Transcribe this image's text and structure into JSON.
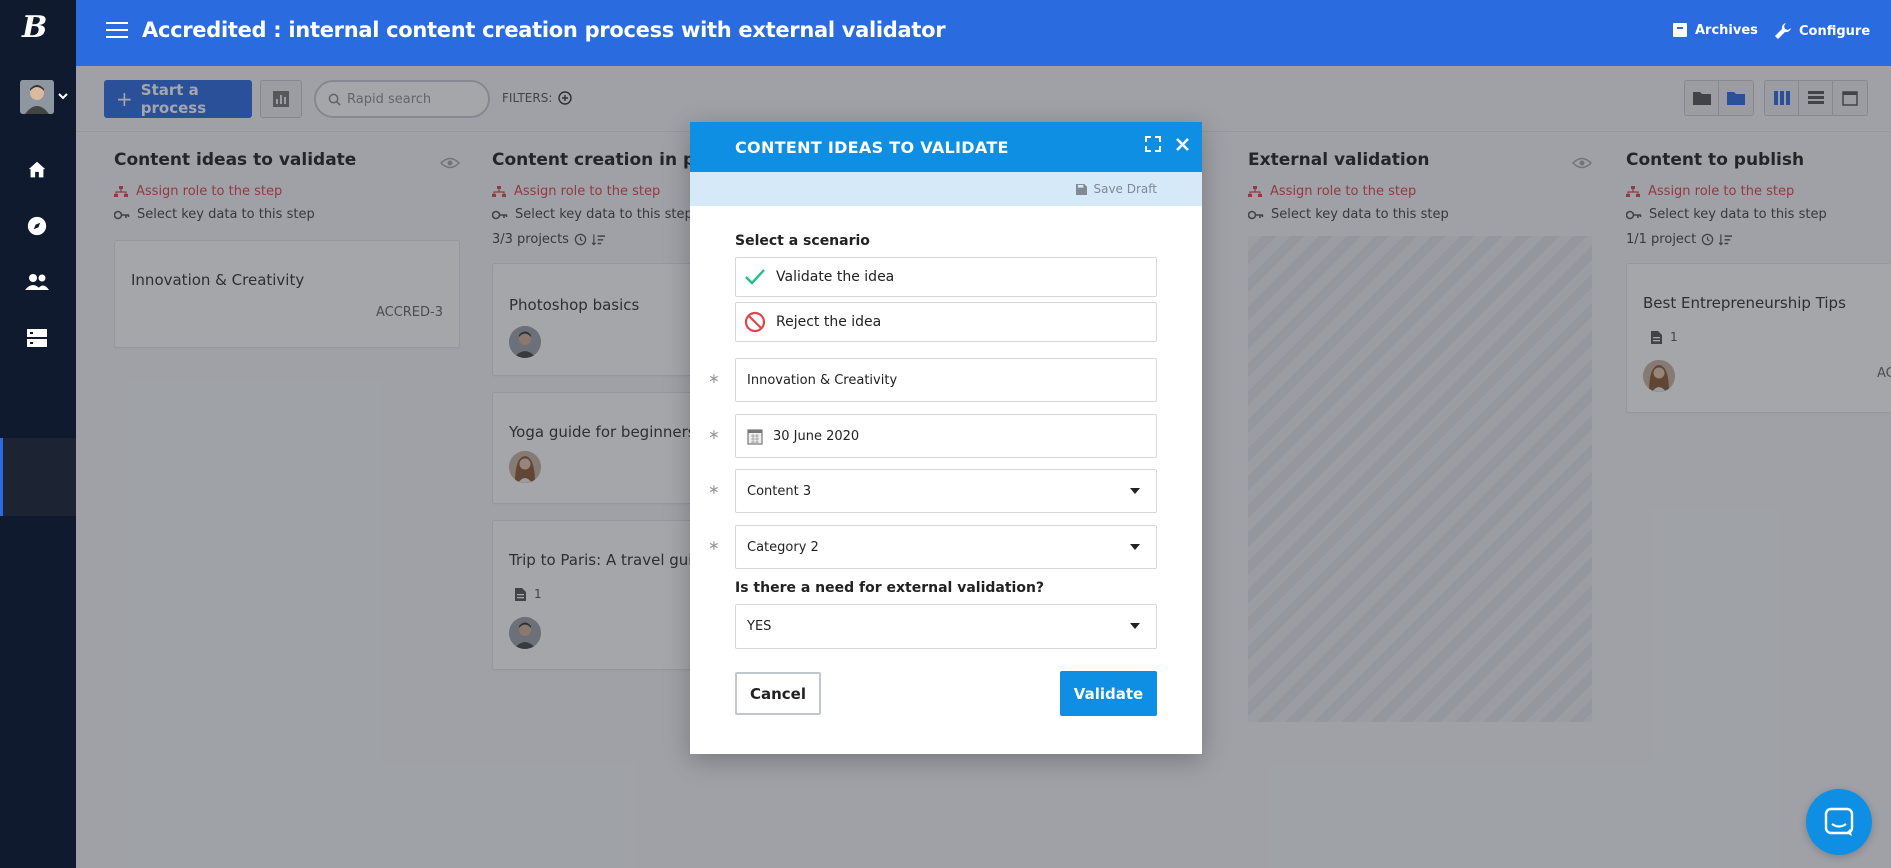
{
  "app": {
    "logo": "B",
    "title": "Accredited : internal content creation process with external validator"
  },
  "header": {
    "archives": "Archives",
    "configure": "Configure"
  },
  "toolbar": {
    "start_process": "Start a process",
    "search_placeholder": "Rapid search",
    "filters": "FILTERS:"
  },
  "columns": [
    {
      "title": "Content ideas to validate",
      "assign_role": "Assign role to the step",
      "key_data": "Select key data to this step"
    },
    {
      "title": "Content creation in progress",
      "assign_role": "Assign role to the step",
      "key_data": "Select key data to this step",
      "count": "3/3 projects"
    },
    {
      "title": "External validation",
      "assign_role": "Assign role to the step",
      "key_data": "Select key data to this step"
    },
    {
      "title": "Content to publish",
      "assign_role": "Assign role to the step",
      "key_data": "Select key data to this step",
      "count": "1/1 project"
    }
  ],
  "cards": {
    "c1": {
      "title": "Innovation & Creativity",
      "id": "ACCRED-3"
    },
    "c2": {
      "title": "Photoshop basics"
    },
    "c3": {
      "title": "Yoga guide for beginners"
    },
    "c4": {
      "title": "Trip to Paris: A travel guide.",
      "docs": "1"
    },
    "c5": {
      "title": "Best Entrepreneurship Tips",
      "docs": "1",
      "id_partial": "AC"
    }
  },
  "modal": {
    "title": "CONTENT IDEAS TO VALIDATE",
    "save_draft": "Save Draft",
    "scenario_label": "Select a scenario",
    "scenarios": [
      "Validate the idea",
      "Reject the idea"
    ],
    "name_value": "Innovation & Creativity",
    "date_value": "30 June 2020",
    "content_value": "Content 3",
    "category_value": "Category 2",
    "question": "Is there a need for external validation?",
    "answer_value": "YES",
    "cancel": "Cancel",
    "validate": "Validate",
    "required_mark": "∗"
  },
  "colors": {
    "primary": "#2a6ce0",
    "modal_accent": "#0f8fe4",
    "nav": "#0f1a2e",
    "warning": "#e0454d",
    "success": "#21c087"
  }
}
